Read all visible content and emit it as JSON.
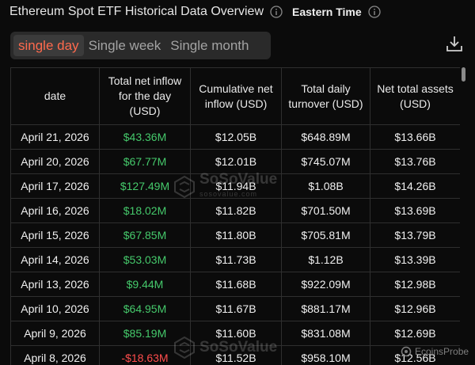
{
  "header": {
    "title": "Ethereum Spot ETF Historical Data Overview",
    "timezone_label": "Eastern Time"
  },
  "tabs": [
    {
      "label": "single day",
      "active": true
    },
    {
      "label": "Single week",
      "active": false
    },
    {
      "label": "Single month",
      "active": false
    }
  ],
  "table": {
    "columns": [
      "date",
      "Total net inflow for the day (USD)",
      "Cumulative net inflow (USD)",
      "Total daily turnover (USD)",
      "Net total assets (USD)"
    ],
    "rows": [
      {
        "date": "April 21, 2026",
        "net_inflow": "$43.36M",
        "cumulative": "$12.05B",
        "turnover": "$648.89M",
        "assets": "$13.66B",
        "sign": "pos"
      },
      {
        "date": "April 20, 2026",
        "net_inflow": "$67.77M",
        "cumulative": "$12.01B",
        "turnover": "$745.07M",
        "assets": "$13.76B",
        "sign": "pos"
      },
      {
        "date": "April 17, 2026",
        "net_inflow": "$127.49M",
        "cumulative": "$11.94B",
        "turnover": "$1.08B",
        "assets": "$14.26B",
        "sign": "pos"
      },
      {
        "date": "April 16, 2026",
        "net_inflow": "$18.02M",
        "cumulative": "$11.82B",
        "turnover": "$701.50M",
        "assets": "$13.69B",
        "sign": "pos"
      },
      {
        "date": "April 15, 2026",
        "net_inflow": "$67.85M",
        "cumulative": "$11.80B",
        "turnover": "$705.81M",
        "assets": "$13.79B",
        "sign": "pos"
      },
      {
        "date": "April 14, 2026",
        "net_inflow": "$53.03M",
        "cumulative": "$11.73B",
        "turnover": "$1.12B",
        "assets": "$13.39B",
        "sign": "pos"
      },
      {
        "date": "April 13, 2026",
        "net_inflow": "$9.44M",
        "cumulative": "$11.68B",
        "turnover": "$922.09M",
        "assets": "$12.98B",
        "sign": "pos"
      },
      {
        "date": "April 10, 2026",
        "net_inflow": "$64.95M",
        "cumulative": "$11.67B",
        "turnover": "$881.17M",
        "assets": "$12.96B",
        "sign": "pos"
      },
      {
        "date": "April 9, 2026",
        "net_inflow": "$85.19M",
        "cumulative": "$11.60B",
        "turnover": "$831.08M",
        "assets": "$12.69B",
        "sign": "pos"
      },
      {
        "date": "April 8, 2026",
        "net_inflow": "-$18.63M",
        "cumulative": "$11.52B",
        "turnover": "$958.10M",
        "assets": "$12.56B",
        "sign": "neg"
      }
    ]
  },
  "watermark": {
    "brand": "SoSoValue",
    "url": "sosovalue.com"
  },
  "footer": {
    "brand": "EcoinsProbe"
  },
  "colors": {
    "positive": "#45c96b",
    "negative": "#ff4d4d",
    "active_tab": "#ff6a4d",
    "background": "#0b0b0b"
  },
  "icons": {
    "info": "info-circle-icon",
    "download": "download-icon"
  }
}
